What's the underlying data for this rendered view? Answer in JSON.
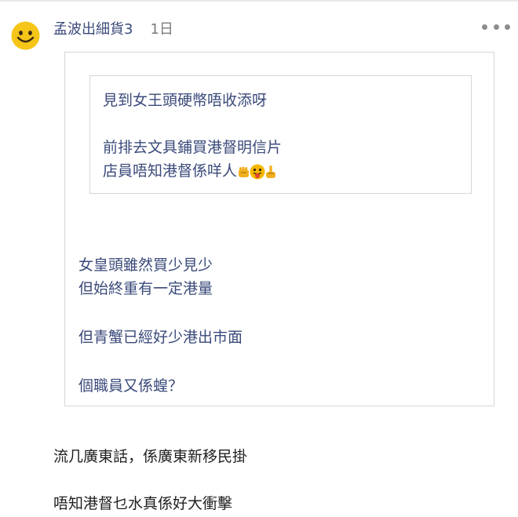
{
  "post": {
    "username": "孟波出細貨3",
    "timestamp": "1日",
    "avatar_icon": "smiley-face-icon",
    "more_icon": "more-options-icon"
  },
  "nested_quote": {
    "line1": "見到女王頭硬幣唔收添呀",
    "line2": "前排去文具鋪買港督明信片",
    "line3": "店員唔知港督係咩人",
    "emojis": [
      "fist-icon",
      "tongue-out-face-icon",
      "middle-finger-icon"
    ]
  },
  "quote": {
    "line1": "女皇頭雖然買少見少",
    "line2": "但始終重有一定港量",
    "line3": "但青蟹已經好少港出市面",
    "line4": "個職員又係蝗？"
  },
  "reply": {
    "line1": "流几廣東話，係廣東新移民掛",
    "line2": "唔知港督乜水真係好大衝擊"
  },
  "colors": {
    "quote_text": "#3a4a7a",
    "body_text": "#1f1f1f",
    "border": "#d6d6d6",
    "avatar": "#f5c518"
  }
}
